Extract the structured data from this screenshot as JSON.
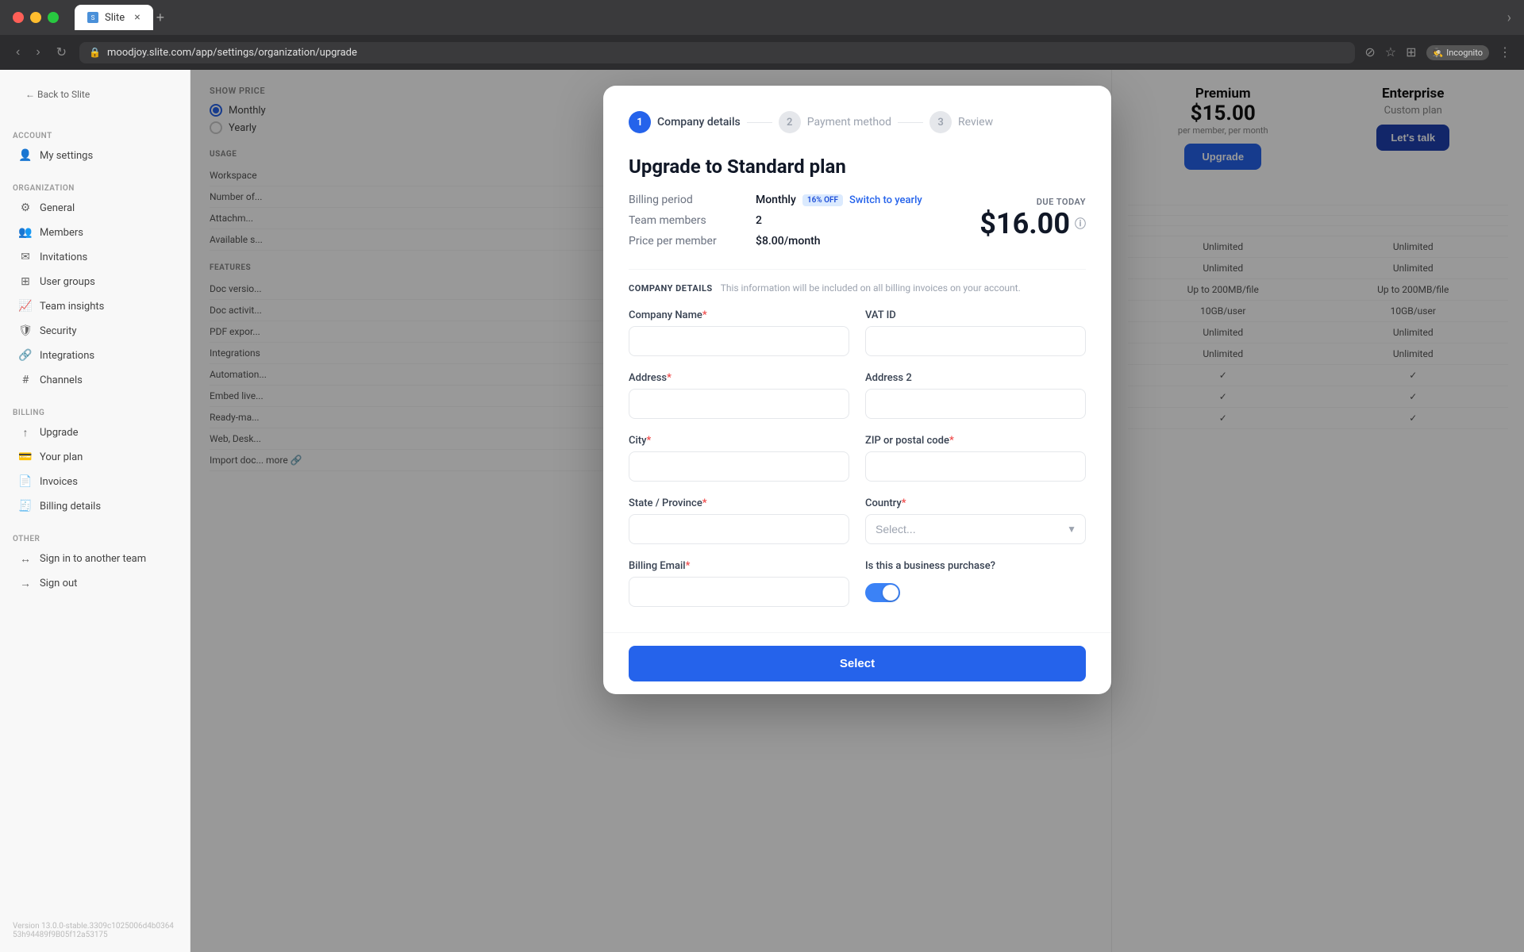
{
  "browser": {
    "tab_title": "Slite",
    "url": "moodjoy.slite.com/app/settings/organization/upgrade",
    "incognito_label": "Incognito"
  },
  "sidebar": {
    "back_label": "Back to Slite",
    "sections": [
      {
        "label": "ACCOUNT",
        "items": [
          {
            "icon": "person",
            "label": "My settings"
          }
        ]
      },
      {
        "label": "ORGANIZATION",
        "items": [
          {
            "icon": "gear",
            "label": "General"
          },
          {
            "icon": "people",
            "label": "Members"
          },
          {
            "icon": "mail",
            "label": "Invitations"
          },
          {
            "icon": "grid",
            "label": "User groups"
          },
          {
            "icon": "chart",
            "label": "Team insights"
          },
          {
            "icon": "shield",
            "label": "Security"
          },
          {
            "icon": "puzzle",
            "label": "Integrations"
          },
          {
            "icon": "hash",
            "label": "Channels"
          }
        ]
      },
      {
        "label": "BILLING",
        "items": [
          {
            "icon": "up-arrow",
            "label": "Upgrade"
          },
          {
            "icon": "plan",
            "label": "Your plan"
          },
          {
            "icon": "invoice",
            "label": "Invoices"
          },
          {
            "icon": "billing",
            "label": "Billing details"
          }
        ]
      },
      {
        "label": "OTHER",
        "items": [
          {
            "icon": "switch",
            "label": "Sign in to another team"
          },
          {
            "icon": "signout",
            "label": "Sign out"
          }
        ]
      }
    ],
    "version": "Version 13.0.0-stable.3309c1025006d4b036453h94489f9B05f12a53175"
  },
  "background": {
    "show_price_label": "SHOW PRICE",
    "radio_monthly": "Monthly",
    "radio_yearly": "Yearly",
    "usage_label": "USAGE",
    "usage_items": [
      {
        "name": "Workspace",
        "premium": "",
        "enterprise": ""
      },
      {
        "name": "Number of...",
        "premium": "",
        "enterprise": ""
      },
      {
        "name": "Attachm...",
        "premium": "",
        "enterprise": ""
      },
      {
        "name": "Available s...",
        "premium": "",
        "enterprise": ""
      }
    ],
    "features_label": "FEATURES",
    "features_items": [
      {
        "name": "Doc versio...",
        "premium": "Unlimited",
        "enterprise": "Unlimited"
      },
      {
        "name": "Doc activit...",
        "premium": "Unlimited",
        "enterprise": "Unlimited"
      },
      {
        "name": "PDF expor...",
        "premium": "Up to 200MB/file",
        "enterprise": "Up to 200MB/file"
      },
      {
        "name": "Integrations",
        "premium": "10GB/user",
        "enterprise": "10GB/user"
      },
      {
        "name": "Automation...",
        "premium": "Unlimited",
        "enterprise": "Unlimited"
      },
      {
        "name": "Embed live...",
        "premium": "Unlimited",
        "enterprise": "Unlimited"
      },
      {
        "name": "Ready-ma...",
        "premium": "✓",
        "enterprise": "✓"
      },
      {
        "name": "Web, Desk...",
        "premium": "✓",
        "enterprise": "✓"
      },
      {
        "name": "Import doc... more",
        "premium": "✓",
        "enterprise": "✓"
      }
    ]
  },
  "pricing_right": {
    "premium": {
      "name": "Premium",
      "price": "$15.00",
      "period": "per member, per month",
      "btn_label": "Upgrade"
    },
    "enterprise": {
      "name": "Enterprise",
      "plan_label": "Custom plan",
      "btn_label": "Let's talk"
    }
  },
  "modal": {
    "stepper": [
      {
        "number": "1",
        "label": "Company details",
        "active": true
      },
      {
        "number": "2",
        "label": "Payment method",
        "active": false
      },
      {
        "number": "3",
        "label": "Review",
        "active": false
      }
    ],
    "title": "Upgrade to Standard plan",
    "billing_period_label": "Billing period",
    "billing_period_value": "Monthly",
    "billing_badge": "16% OFF",
    "billing_switch": "Switch to yearly",
    "team_members_label": "Team members",
    "team_members_value": "2",
    "price_per_member_label": "Price per member",
    "price_per_member_value": "$8.00/month",
    "due_today_label": "DUE TODAY",
    "due_today_amount": "$16.00",
    "section_title": "COMPANY DETAILS",
    "section_subtitle": "This information will be included on all billing invoices on your account.",
    "form": {
      "company_name_label": "Company Name",
      "company_name_required": true,
      "vat_id_label": "VAT ID",
      "vat_id_required": false,
      "address_label": "Address",
      "address_required": true,
      "address2_label": "Address 2",
      "address2_required": false,
      "city_label": "City",
      "city_required": true,
      "zip_label": "ZIP or postal code",
      "zip_required": true,
      "state_label": "State / Province",
      "state_required": true,
      "country_label": "Country",
      "country_required": true,
      "country_placeholder": "Select...",
      "billing_email_label": "Billing Email",
      "billing_email_required": true,
      "business_purchase_label": "Is this a business purchase?"
    },
    "select_btn_label": "Select"
  }
}
